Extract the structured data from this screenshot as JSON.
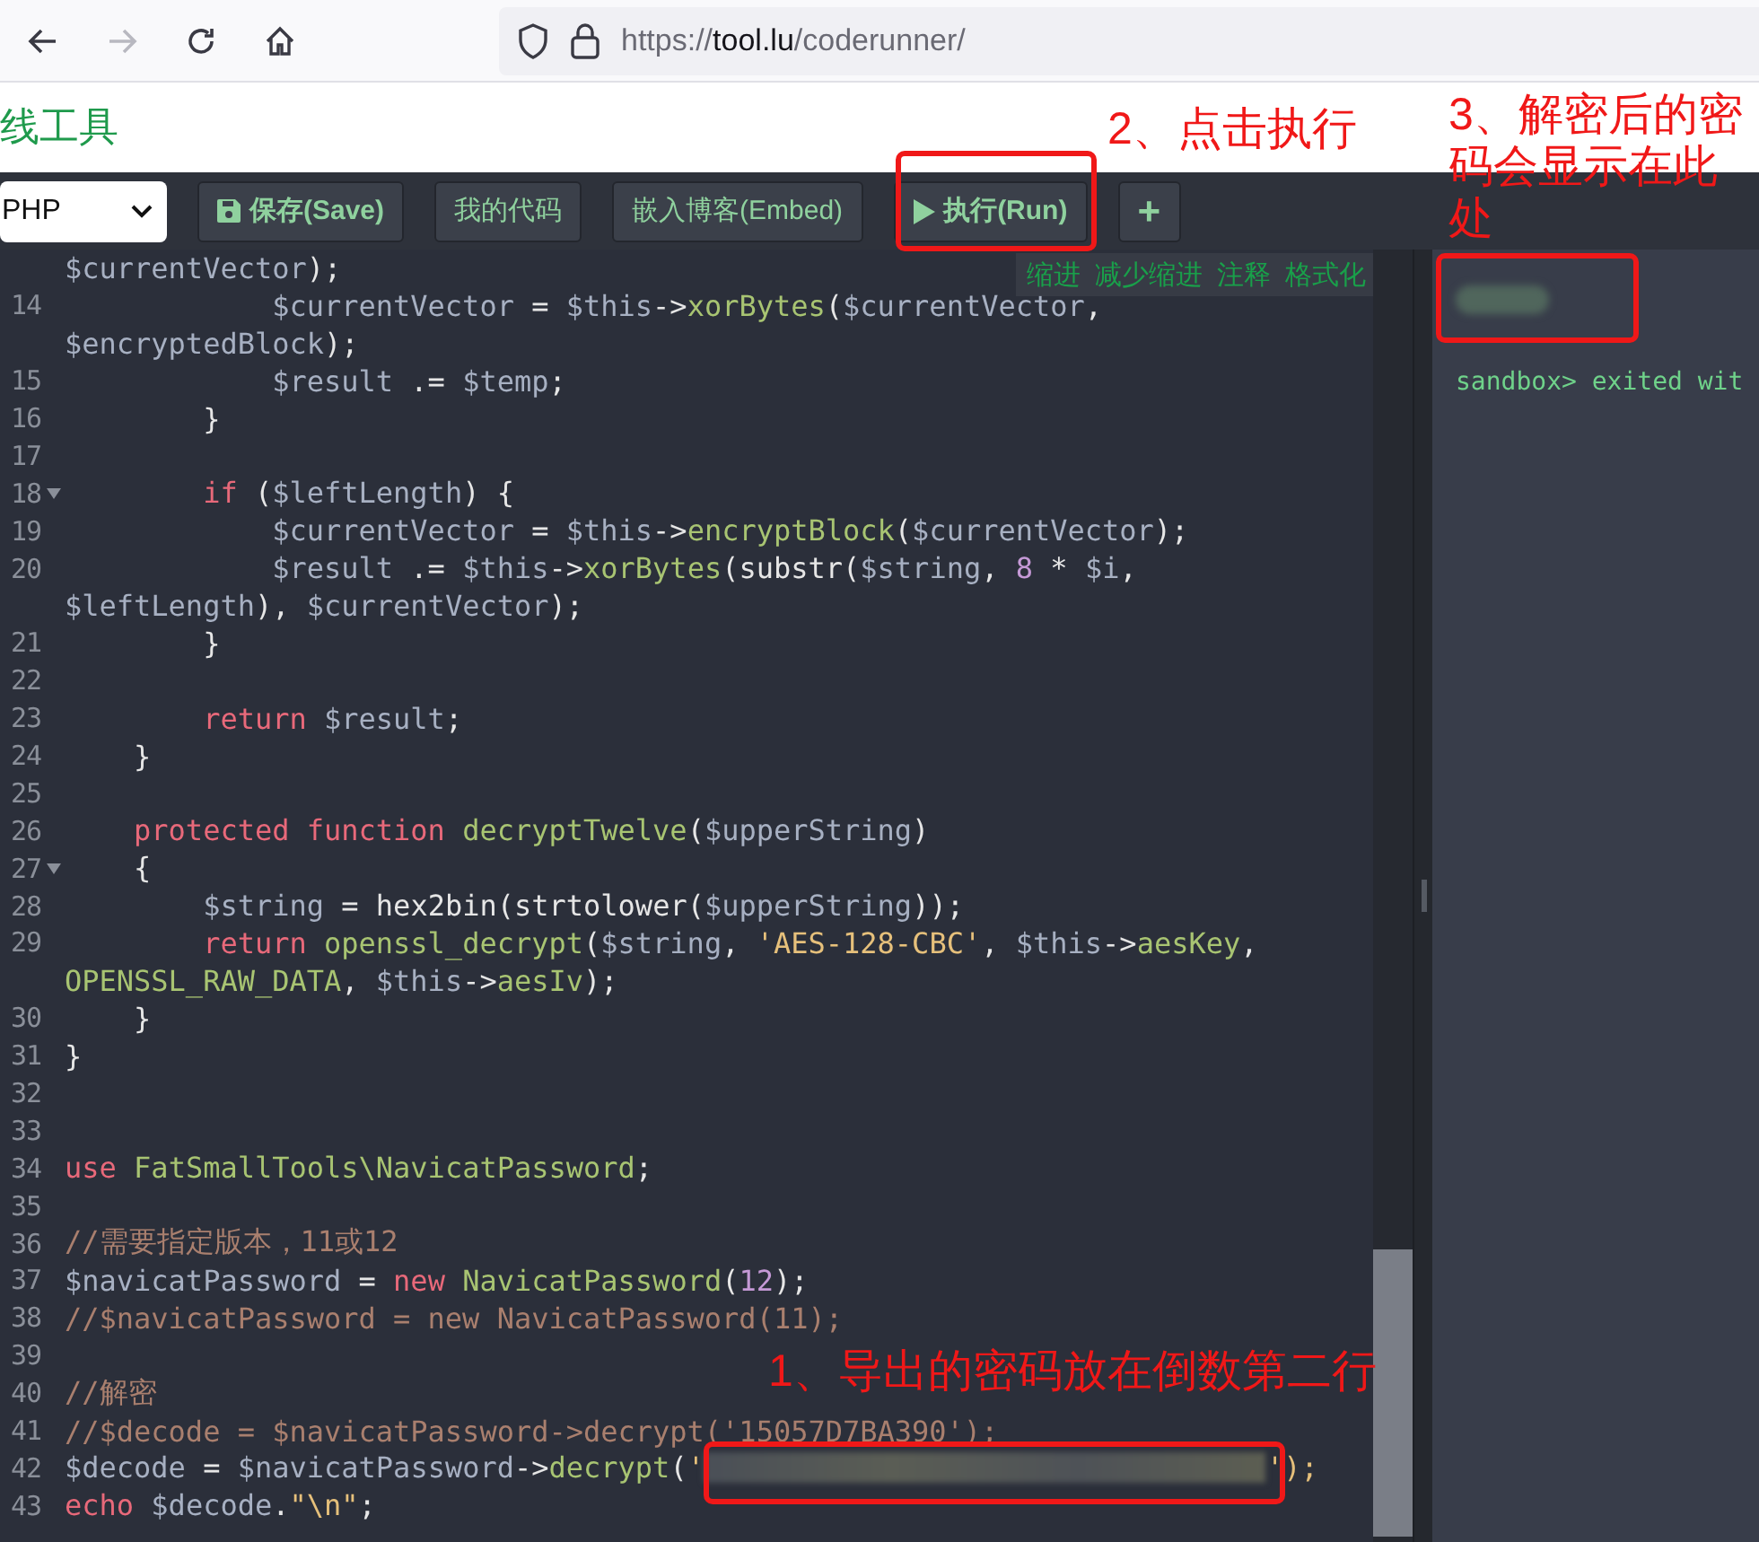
{
  "browser": {
    "url": "https://**tool.lu**/coderunner/",
    "forward_disabled": true
  },
  "header": {
    "title": "线工具"
  },
  "toolbar": {
    "language": "PHP",
    "buttons": [
      {
        "kind": "save",
        "label": "保存(Save)"
      },
      {
        "kind": "plain",
        "label": "我的代码"
      },
      {
        "kind": "plain",
        "label": "嵌入博客(Embed)"
      },
      {
        "kind": "run",
        "label": "执行(Run)"
      },
      {
        "kind": "add",
        "label": "+"
      }
    ]
  },
  "quick_actions": [
    "缩进",
    "减少缩进",
    "注释",
    "格式化"
  ],
  "code": [
    {
      "text": "$currentVector);"
    },
    {
      "number": "14",
      "fold": false,
      "text": "            $currentVector = $this->xorBytes($currentVector,"
    },
    {
      "text": "$encryptedBlock);"
    },
    {
      "number": "15",
      "fold": false,
      "text": "            $result .= $temp;"
    },
    {
      "number": "16",
      "fold": false,
      "text": "        }"
    },
    {
      "number": "17",
      "fold": false
    },
    {
      "number": "18",
      "fold": true,
      "text": "        if ($leftLength) {"
    },
    {
      "number": "19",
      "fold": false,
      "text": "            $currentVector = $this->encryptBlock($currentVector);"
    },
    {
      "number": "20",
      "fold": false,
      "text": "            $result .= $this->xorBytes(substr($string, 8 * $i,"
    },
    {
      "text": "$leftLength), $currentVector);"
    },
    {
      "number": "21",
      "fold": false,
      "text": "        }"
    },
    {
      "number": "22",
      "fold": false
    },
    {
      "number": "23",
      "fold": false,
      "text": "        return $result;"
    },
    {
      "number": "24",
      "fold": false,
      "text": "    }"
    },
    {
      "number": "25",
      "fold": false
    },
    {
      "number": "26",
      "fold": false,
      "text": "    protected function decryptTwelve($upperString)"
    },
    {
      "number": "27",
      "fold": true,
      "text": "    {"
    },
    {
      "number": "28",
      "fold": false,
      "text": "        $string = hex2bin(strtolower($upperString));"
    },
    {
      "number": "29",
      "fold": false,
      "text": "        return openssl_decrypt($string, 'AES-128-CBC', $this->aesKey,"
    },
    {
      "text": "OPENSSL_RAW_DATA, $this->aesIv);"
    },
    {
      "number": "30",
      "fold": false,
      "text": "    }"
    },
    {
      "number": "31",
      "fold": false,
      "text": "}"
    },
    {
      "number": "32",
      "fold": false
    },
    {
      "number": "33",
      "fold": false
    },
    {
      "number": "34",
      "fold": false,
      "text": "use FatSmallTools\\NavicatPassword;"
    },
    {
      "number": "35",
      "fold": false
    },
    {
      "number": "36",
      "fold": false,
      "text": "//需要指定版本，11或12"
    },
    {
      "number": "37",
      "fold": false,
      "text": "$navicatPassword = new NavicatPassword(12);"
    },
    {
      "number": "38",
      "fold": false,
      "text": "//$navicatPassword = new NavicatPassword(11);"
    },
    {
      "number": "39",
      "fold": false
    },
    {
      "number": "40",
      "fold": false,
      "text": "//解密"
    },
    {
      "number": "41",
      "fold": false,
      "text": "//$decode = $navicatPassword->decrypt('15057D7BA390');"
    },
    {
      "number": "42",
      "fold": false,
      "text": "$decode = $navicatPassword->decrypt('",
      "redacted": true,
      "text_after": "');"
    },
    {
      "number": "43",
      "fold": false,
      "text": "echo $decode.\"\\n\";"
    }
  ],
  "output": {
    "line": "sandbox> exited wit"
  },
  "annotations": [
    {
      "kind": "note",
      "text": "2、点击执行"
    },
    {
      "kind": "note",
      "text": "3、解密后的密码会显示在此处"
    },
    {
      "kind": "note",
      "text": "1、导出的密码放在倒数第二行"
    }
  ]
}
